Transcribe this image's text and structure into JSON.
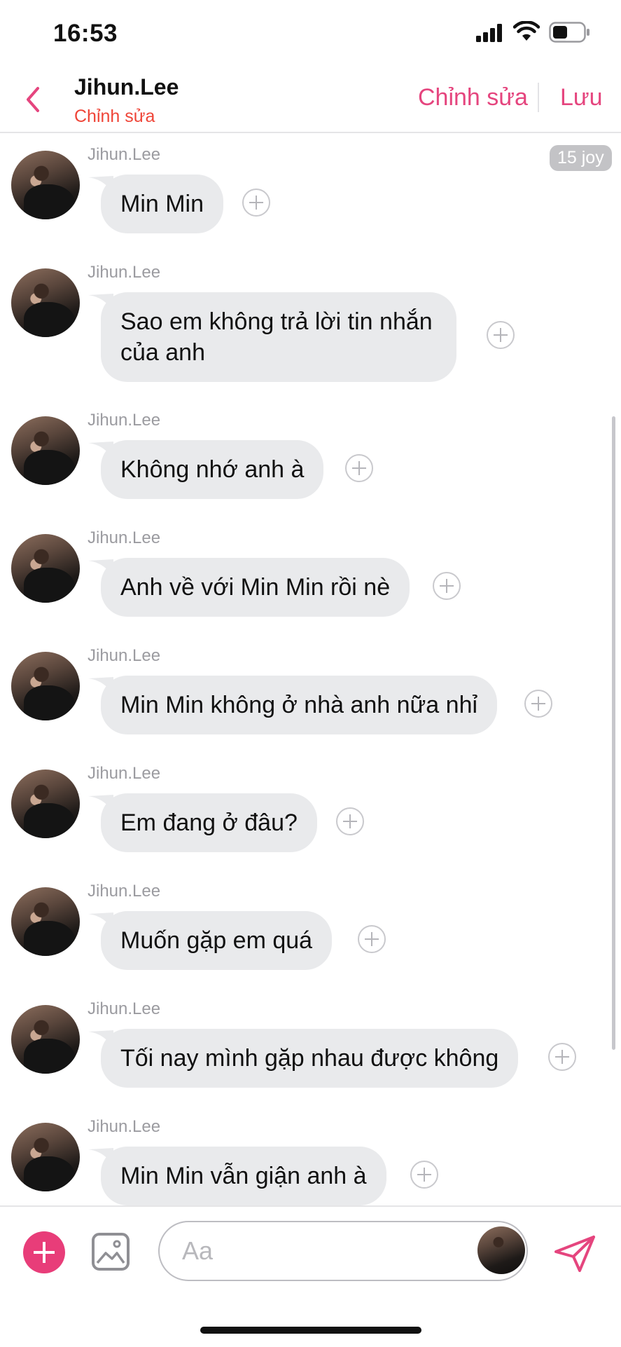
{
  "status_bar": {
    "time": "16:53"
  },
  "header": {
    "title": "Jihun.Lee",
    "subtitle": "Chỉnh sửa",
    "edit_label": "Chỉnh sửa",
    "save_label": "Lưu"
  },
  "joy_badge": "15 joy",
  "messages": [
    {
      "sender": "Jihun.Lee",
      "text": "Min Min"
    },
    {
      "sender": "Jihun.Lee",
      "text": "Sao em không trả lời tin nhắn của anh"
    },
    {
      "sender": "Jihun.Lee",
      "text": "Không nhớ anh à"
    },
    {
      "sender": "Jihun.Lee",
      "text": "Anh về với Min Min rồi nè"
    },
    {
      "sender": "Jihun.Lee",
      "text": "Min Min không ở nhà anh nữa nhỉ"
    },
    {
      "sender": "Jihun.Lee",
      "text": "Em đang ở đâu?"
    },
    {
      "sender": "Jihun.Lee",
      "text": "Muốn gặp em quá"
    },
    {
      "sender": "Jihun.Lee",
      "text": "Tối nay mình gặp nhau được không"
    },
    {
      "sender": "Jihun.Lee",
      "text": "Min Min vẫn giận anh à"
    }
  ],
  "composer": {
    "placeholder": "Aa"
  },
  "colors": {
    "accent": "#e5457e",
    "subtitle": "#ef4538",
    "bubble": "#e9eaec"
  }
}
